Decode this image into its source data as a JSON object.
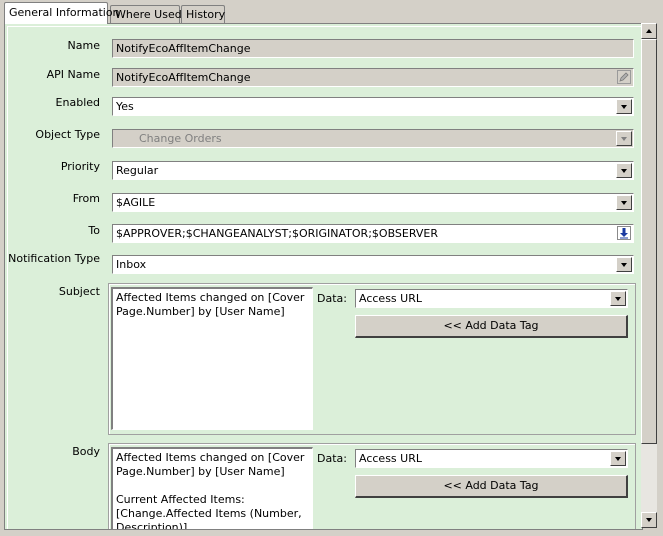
{
  "tabs": [
    {
      "label": "General Information",
      "active": true
    },
    {
      "label": "Where Used",
      "active": false
    },
    {
      "label": "History",
      "active": false
    }
  ],
  "form": {
    "name": {
      "label": "Name",
      "value": "NotifyEcoAffItemChange"
    },
    "api_name": {
      "label": "API Name",
      "value": "NotifyEcoAffItemChange"
    },
    "enabled": {
      "label": "Enabled",
      "value": "Yes"
    },
    "object_type": {
      "label": "Object Type",
      "value": "Change Orders"
    },
    "priority": {
      "label": "Priority",
      "value": "Regular"
    },
    "from": {
      "label": "From",
      "value": "$AGILE"
    },
    "to": {
      "label": "To",
      "value": "$APPROVER;$CHANGEANALYST;$ORIGINATOR;$OBSERVER"
    },
    "notification_type": {
      "label": "Notification Type",
      "value": "Inbox"
    },
    "subject": {
      "label": "Subject",
      "lines": [
        "Affected Items changed on [Cover",
        "Page.Number] by [User Name]"
      ],
      "data_label": "Data:",
      "data_value": "Access URL",
      "add_button": "<< Add Data Tag"
    },
    "body": {
      "label": "Body",
      "lines": [
        "Affected Items changed on [Cover",
        "Page.Number] by [User Name]",
        "",
        "Current Affected Items:",
        "[Change.Affected Items (Number,",
        "Description)]"
      ],
      "data_label": "Data:",
      "data_value": "Access URL",
      "add_button": "<< Add Data Tag"
    }
  },
  "colors": {
    "panel_background": "#dbefd9",
    "chrome": "#d4d0c8",
    "to_lookup_icon": "#1a3aa0"
  },
  "icons": {
    "api_name_edit": "edit-pencil-icon",
    "to_lookup": "blue-down-arrow-icon"
  }
}
